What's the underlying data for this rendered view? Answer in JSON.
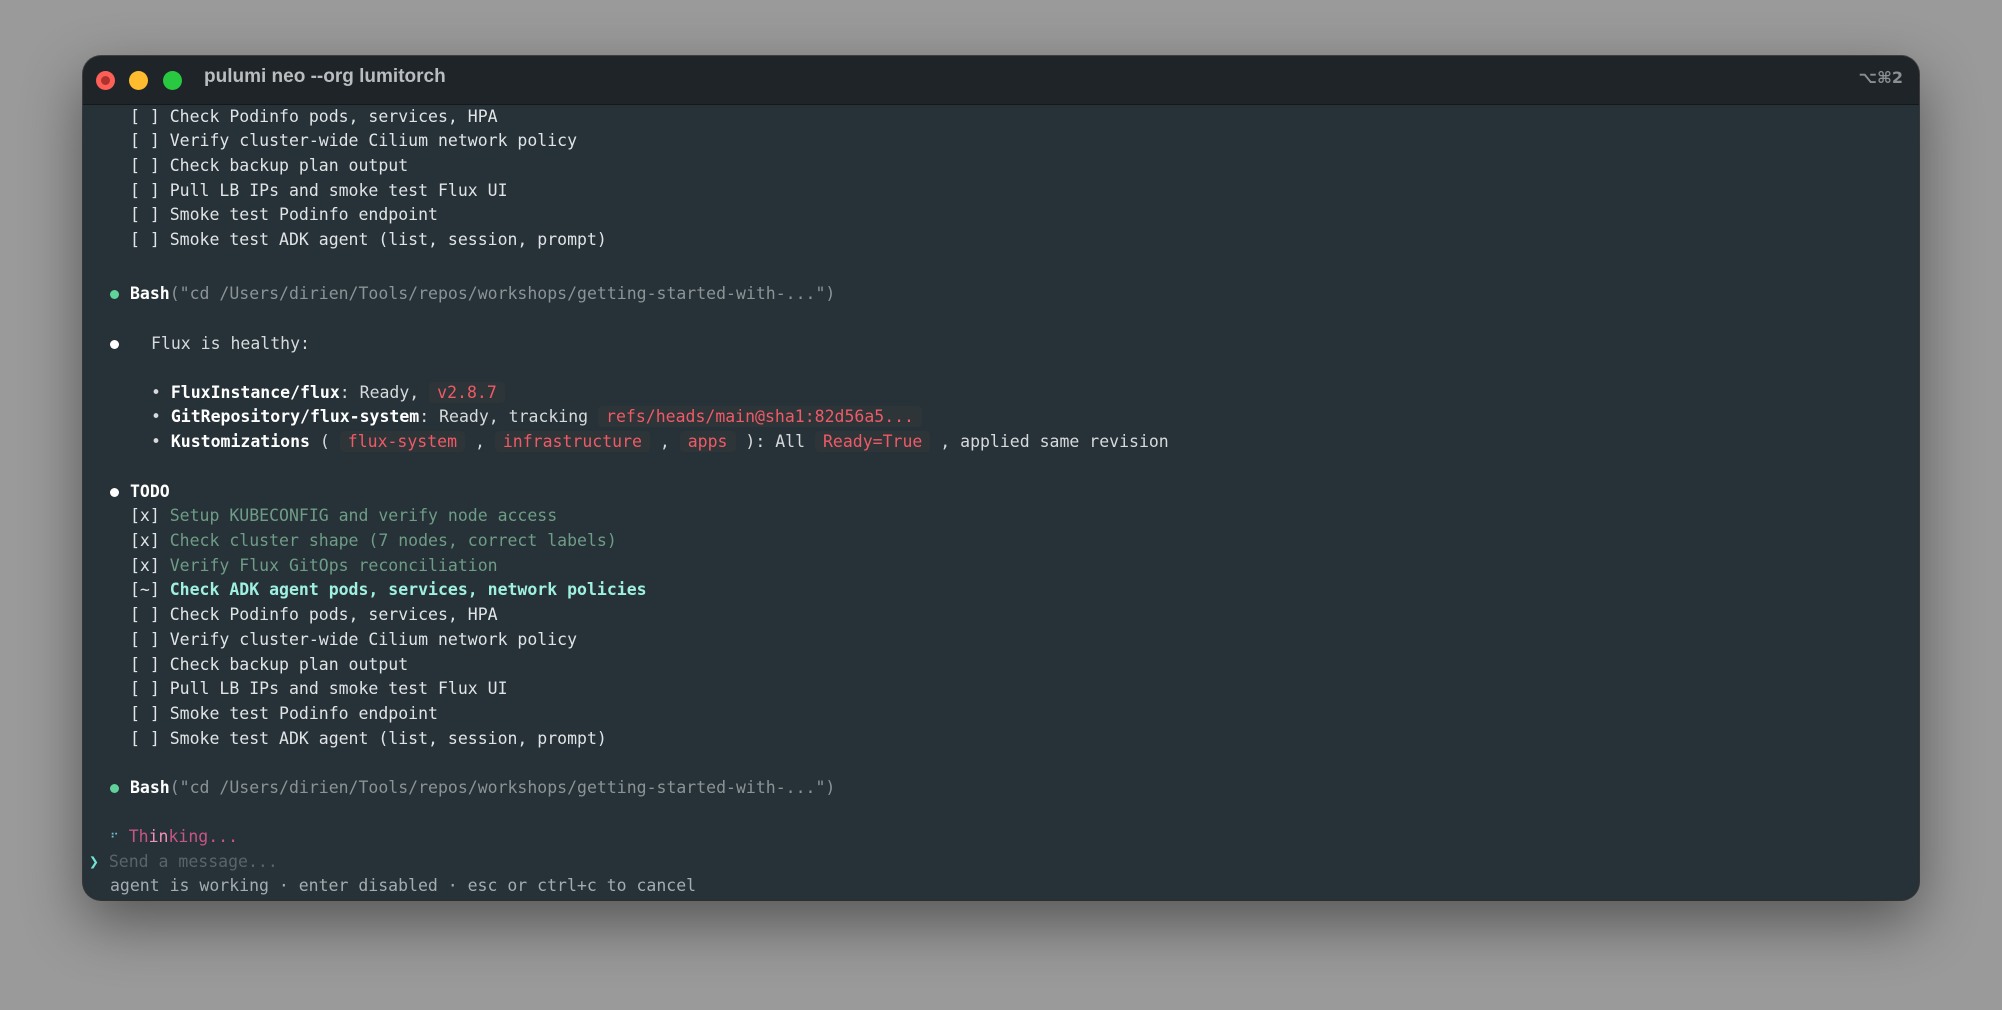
{
  "window": {
    "title": "pulumi neo --org lumitorch",
    "shortcut": "⌥⌘2"
  },
  "top_todos": [
    {
      "box": "[ ]",
      "label": "Check Podinfo pods, services, HPA",
      "state": "pending"
    },
    {
      "box": "[ ]",
      "label": "Verify cluster-wide Cilium network policy",
      "state": "pending"
    },
    {
      "box": "[ ]",
      "label": "Check backup plan output",
      "state": "pending"
    },
    {
      "box": "[ ]",
      "label": "Pull LB IPs and smoke test Flux UI",
      "state": "pending"
    },
    {
      "box": "[ ]",
      "label": "Smoke test Podinfo endpoint",
      "state": "pending"
    },
    {
      "box": "[ ]",
      "label": "Smoke test ADK agent (list, session, prompt)",
      "state": "pending"
    }
  ],
  "bash_call_1": {
    "tool": "Bash",
    "args": "(\"cd /Users/dirien/Tools/repos/workshops/getting-started-with-...\")"
  },
  "flux_status": {
    "heading": "Flux is healthy:",
    "bullet": "•",
    "instance": {
      "name": "FluxInstance/flux",
      "text": ": Ready, ",
      "code": "v2.8.7"
    },
    "gitrepo": {
      "name": "GitRepository/flux-system",
      "text": ": Ready, tracking ",
      "code": "refs/heads/main@sha1:82d56a5..."
    },
    "kustomizations": {
      "name": "Kustomizations",
      "open": " ( ",
      "code1": "flux-system",
      "sep1": " , ",
      "code2": "infrastructure",
      "sep2": " , ",
      "code3": "apps",
      "mid": " ): All ",
      "code4": "Ready=True",
      "tail": " , applied same revision"
    }
  },
  "todo": {
    "heading": "TODO",
    "items": [
      {
        "box": "[x]",
        "label": "Setup KUBECONFIG and verify node access",
        "state": "done"
      },
      {
        "box": "[x]",
        "label": "Check cluster shape (7 nodes, correct labels)",
        "state": "done"
      },
      {
        "box": "[x]",
        "label": "Verify Flux GitOps reconciliation",
        "state": "done"
      },
      {
        "box": "[~]",
        "label": "Check ADK agent pods, services, network policies",
        "state": "active"
      },
      {
        "box": "[ ]",
        "label": "Check Podinfo pods, services, HPA",
        "state": "pending"
      },
      {
        "box": "[ ]",
        "label": "Verify cluster-wide Cilium network policy",
        "state": "pending"
      },
      {
        "box": "[ ]",
        "label": "Check backup plan output",
        "state": "pending"
      },
      {
        "box": "[ ]",
        "label": "Pull LB IPs and smoke test Flux UI",
        "state": "pending"
      },
      {
        "box": "[ ]",
        "label": "Smoke test Podinfo endpoint",
        "state": "pending"
      },
      {
        "box": "[ ]",
        "label": "Smoke test ADK agent (list, session, prompt)",
        "state": "pending"
      }
    ]
  },
  "bash_call_2": {
    "tool": "Bash",
    "args": "(\"cd /Users/dirien/Tools/repos/workshops/getting-started-with-...\")"
  },
  "thinking": {
    "spinner": "⠋",
    "pre": "Th",
    "hi": "in",
    "post": "king..."
  },
  "input": {
    "caret": "❯",
    "placeholder": "Send a message..."
  },
  "footer": "agent is working · enter disabled · esc or ctrl+c to cancel",
  "colors": {
    "terminal_bg": "#263238",
    "titlebar_bg": "#1e2428",
    "done": "#6f9c86",
    "active": "#9ff0e0",
    "code": "#ef5a66",
    "status_dot": "#5fd39a",
    "thinking": "#c75585"
  }
}
